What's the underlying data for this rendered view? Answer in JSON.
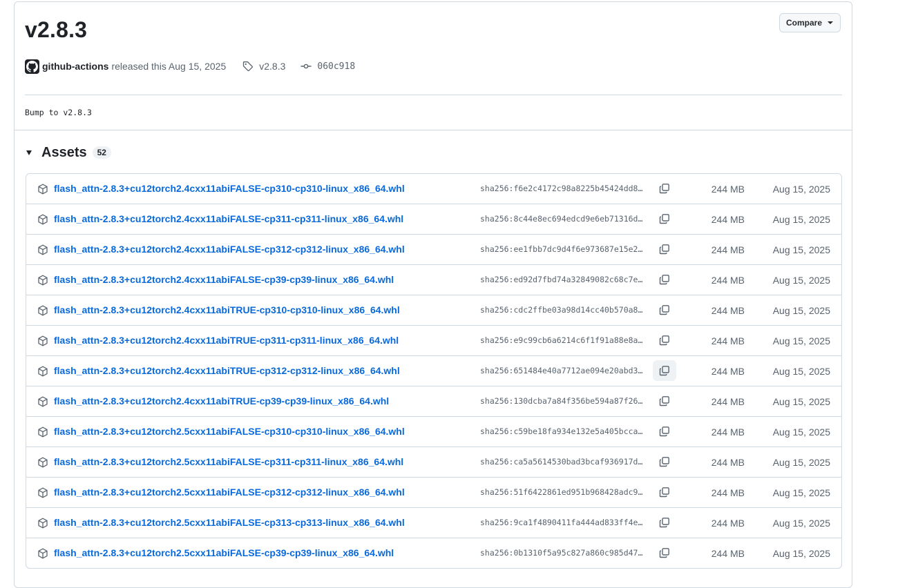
{
  "release": {
    "title": "v2.8.3",
    "author": "github-actions",
    "released_text": "released this Aug 15, 2025",
    "tag": "v2.8.3",
    "commit": "060c918",
    "body": "Bump to v2.8.3",
    "compare_label": "Compare"
  },
  "assets": {
    "title": "Assets",
    "count": "52",
    "items": [
      {
        "name": "flash_attn-2.8.3+cu12torch2.4cxx11abiFALSE-cp310-cp310-linux_x86_64.whl",
        "sha": "sha256:f6e2c4172c98a8225b45424dd8…",
        "size": "244 MB",
        "date": "Aug 15, 2025"
      },
      {
        "name": "flash_attn-2.8.3+cu12torch2.4cxx11abiFALSE-cp311-cp311-linux_x86_64.whl",
        "sha": "sha256:8c44e8ec694edcd9e6eb71316d…",
        "size": "244 MB",
        "date": "Aug 15, 2025"
      },
      {
        "name": "flash_attn-2.8.3+cu12torch2.4cxx11abiFALSE-cp312-cp312-linux_x86_64.whl",
        "sha": "sha256:ee1fbb7dc9d4f6e973687e15e2…",
        "size": "244 MB",
        "date": "Aug 15, 2025"
      },
      {
        "name": "flash_attn-2.8.3+cu12torch2.4cxx11abiFALSE-cp39-cp39-linux_x86_64.whl",
        "sha": "sha256:ed92d7fbd74a32849082c68c7e…",
        "size": "244 MB",
        "date": "Aug 15, 2025"
      },
      {
        "name": "flash_attn-2.8.3+cu12torch2.4cxx11abiTRUE-cp310-cp310-linux_x86_64.whl",
        "sha": "sha256:cdc2ffbe03a98d14cc40b570a8…",
        "size": "244 MB",
        "date": "Aug 15, 2025"
      },
      {
        "name": "flash_attn-2.8.3+cu12torch2.4cxx11abiTRUE-cp311-cp311-linux_x86_64.whl",
        "sha": "sha256:e9c99cb6a6214c6f1f91a88e8a…",
        "size": "244 MB",
        "date": "Aug 15, 2025"
      },
      {
        "name": "flash_attn-2.8.3+cu12torch2.4cxx11abiTRUE-cp312-cp312-linux_x86_64.whl",
        "sha": "sha256:651484e40a7712ae094e20abd3…",
        "size": "244 MB",
        "date": "Aug 15, 2025"
      },
      {
        "name": "flash_attn-2.8.3+cu12torch2.4cxx11abiTRUE-cp39-cp39-linux_x86_64.whl",
        "sha": "sha256:130dcba7a84f356be594a87f26…",
        "size": "244 MB",
        "date": "Aug 15, 2025"
      },
      {
        "name": "flash_attn-2.8.3+cu12torch2.5cxx11abiFALSE-cp310-cp310-linux_x86_64.whl",
        "sha": "sha256:c59be18fa934e132e5a405bcca…",
        "size": "244 MB",
        "date": "Aug 15, 2025"
      },
      {
        "name": "flash_attn-2.8.3+cu12torch2.5cxx11abiFALSE-cp311-cp311-linux_x86_64.whl",
        "sha": "sha256:ca5a5614530bad3bcaf936917d…",
        "size": "244 MB",
        "date": "Aug 15, 2025"
      },
      {
        "name": "flash_attn-2.8.3+cu12torch2.5cxx11abiFALSE-cp312-cp312-linux_x86_64.whl",
        "sha": "sha256:51f6422861ed951b968428adc9…",
        "size": "244 MB",
        "date": "Aug 15, 2025"
      },
      {
        "name": "flash_attn-2.8.3+cu12torch2.5cxx11abiFALSE-cp313-cp313-linux_x86_64.whl",
        "sha": "sha256:9ca1f4890411fa444ad833ff4e…",
        "size": "244 MB",
        "date": "Aug 15, 2025"
      },
      {
        "name": "flash_attn-2.8.3+cu12torch2.5cxx11abiFALSE-cp39-cp39-linux_x86_64.whl",
        "sha": "sha256:0b1310f5a95c827a860c985d47…",
        "size": "244 MB",
        "date": "Aug 15, 2025"
      }
    ]
  },
  "icons": {
    "package": "package-icon",
    "copy": "copy-icon",
    "tag": "tag-icon",
    "commit": "git-commit-icon",
    "avatar": "github-mark-icon"
  },
  "colors": {
    "link": "#0969da",
    "border": "#d1d9e0",
    "muted": "#59636e",
    "text": "#1f2328"
  }
}
